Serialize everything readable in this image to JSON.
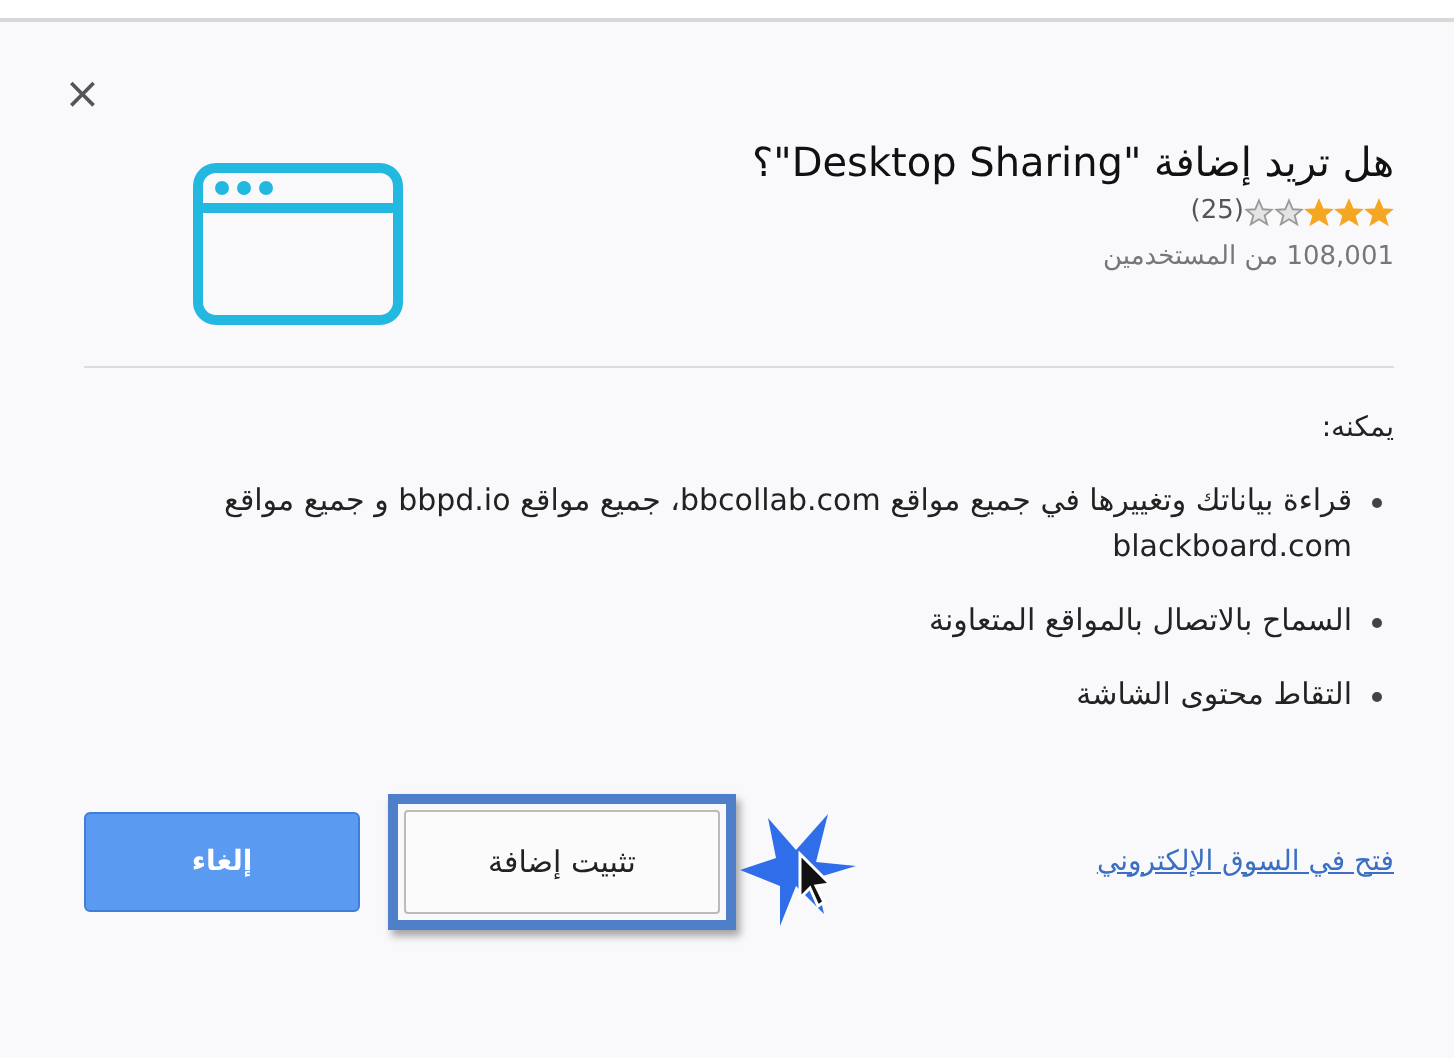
{
  "dialog": {
    "close": "×",
    "title": "هل تريد إضافة \"Desktop Sharing\"؟",
    "rating": {
      "stars": 3,
      "count": "(25)"
    },
    "users": "108,001 من المستخدمين",
    "permissions_heading": "يمكنه:",
    "permissions": [
      "قراءة بياناتك وتغييرها في جميع مواقع bbcollab.com، جميع مواقع bbpd.io و جميع مواقع blackboard.com",
      "السماح بالاتصال بالمواقع المتعاونة",
      "التقاط محتوى الشاشة"
    ],
    "link": "فتح في السوق الإلكتروني",
    "buttons": [
      {
        "label": "تثبيت إضافة",
        "kind": "secondary",
        "highlighted": true
      },
      {
        "label": "إلغاء",
        "kind": "primary",
        "highlighted": false
      }
    ]
  }
}
